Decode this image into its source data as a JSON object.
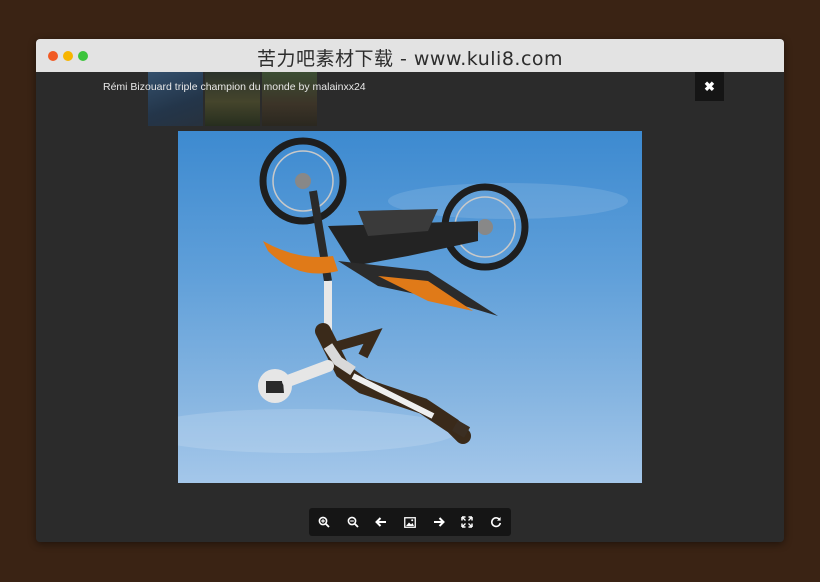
{
  "window": {
    "title": "苦力吧素材下载 - www.kuli8.com"
  },
  "viewer": {
    "caption": "Rémi Bizouard triple champion du monde by malainxx24",
    "close_icon": "✖",
    "thumbnails": [
      {
        "name": "thumbnail-1"
      },
      {
        "name": "thumbnail-2"
      },
      {
        "name": "thumbnail-3"
      }
    ],
    "photo_subject": "freestyle motocross rider upside down in blue sky"
  },
  "toolbar": {
    "buttons": [
      {
        "name": "zoom-in",
        "icon": "zoom-in-icon"
      },
      {
        "name": "zoom-out",
        "icon": "zoom-out-icon"
      },
      {
        "name": "previous",
        "icon": "arrow-left-icon"
      },
      {
        "name": "original-size",
        "icon": "image-icon"
      },
      {
        "name": "next",
        "icon": "arrow-right-icon"
      },
      {
        "name": "fullscreen",
        "icon": "expand-icon"
      },
      {
        "name": "rotate",
        "icon": "rotate-icon"
      }
    ]
  },
  "colors": {
    "page_background": "#3a2314",
    "viewer_background": "#2b2b2b",
    "titlebar": "#e3e3e3",
    "toolbar": "#151515",
    "sky": "#5f9fd9"
  }
}
